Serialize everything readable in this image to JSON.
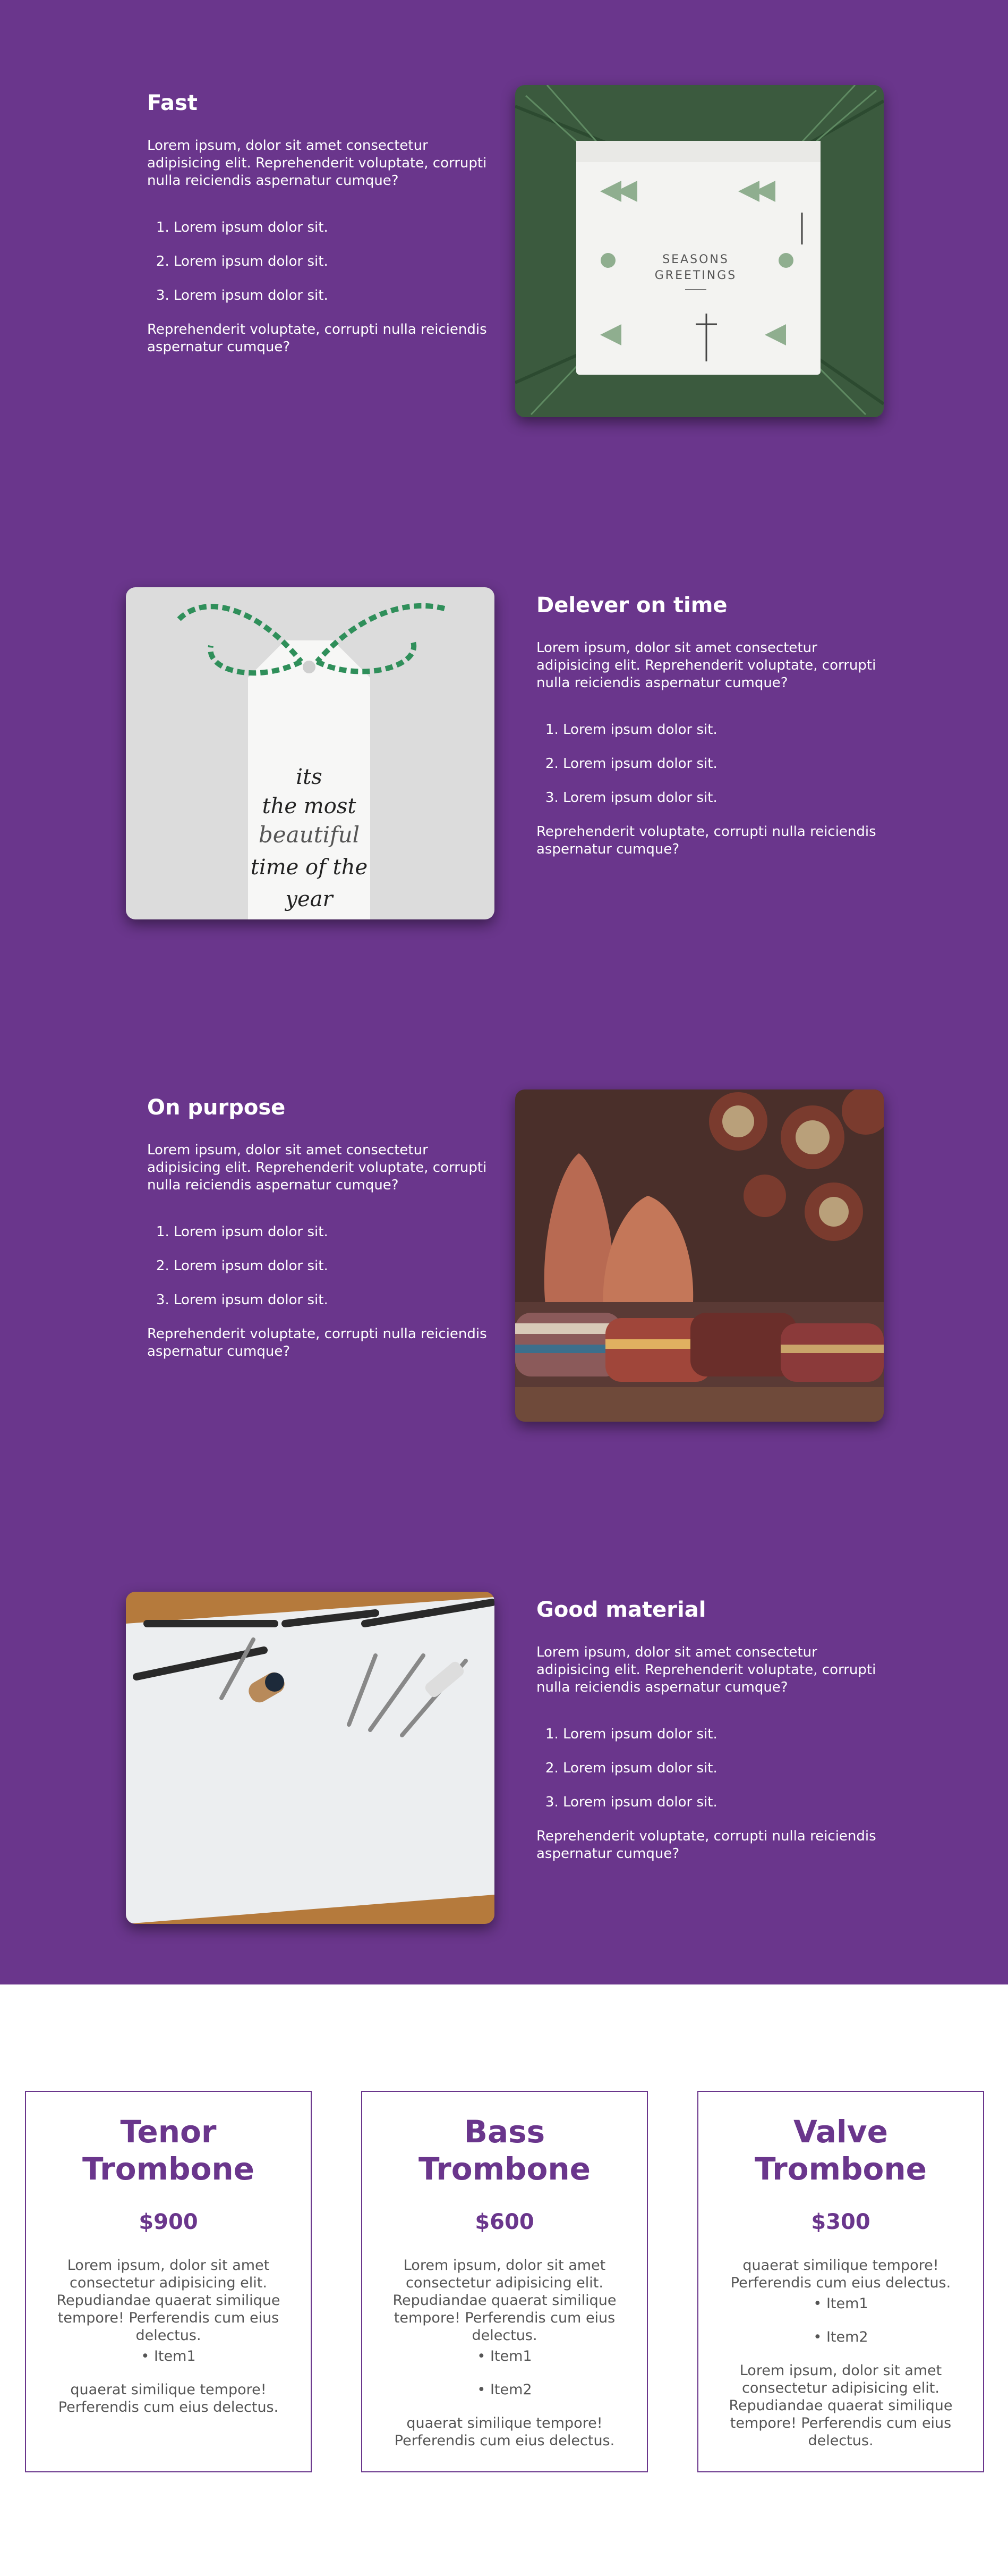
{
  "features": [
    {
      "title": "Fast",
      "intro": "Lorem ipsum, dolor sit amet consectetur adipisicing elit. Reprehenderit voluptate, corrupti nulla reiciendis aspernatur cumque?",
      "items": [
        "Lorem ipsum dolor sit.",
        "Lorem ipsum dolor sit.",
        "Lorem ipsum dolor sit."
      ],
      "outro": "Reprehenderit voluptate, corrupti nulla reiciendis aspernatur cumque?",
      "image": "seasons-greetings-gift-box-photo",
      "image_text": [
        "SEASONS",
        "GREETINGS"
      ]
    },
    {
      "title": "Delever on time",
      "intro": "Lorem ipsum, dolor sit amet consectetur adipisicing elit. Reprehenderit voluptate, corrupti nulla reiciendis aspernatur cumque?",
      "items": [
        "Lorem ipsum dolor sit.",
        "Lorem ipsum dolor sit.",
        "Lorem ipsum dolor sit."
      ],
      "outro": "Reprehenderit voluptate, corrupti nulla reiciendis aspernatur cumque?",
      "image": "gift-tag-photo",
      "image_text": [
        "its",
        "the most",
        "beautiful",
        "time of the",
        "year"
      ]
    },
    {
      "title": "On purpose",
      "intro": "Lorem ipsum, dolor sit amet consectetur adipisicing elit. Reprehenderit voluptate, corrupti nulla reiciendis aspernatur cumque?",
      "items": [
        "Lorem ipsum dolor sit.",
        "Lorem ipsum dolor sit.",
        "Lorem ipsum dolor sit."
      ],
      "outro": "Reprehenderit voluptate, corrupti nulla reiciendis aspernatur cumque?",
      "image": "clay-pots-bazaar-photo"
    },
    {
      "title": "Good material",
      "intro": "Lorem ipsum, dolor sit amet consectetur adipisicing elit. Reprehenderit voluptate, corrupti nulla reiciendis aspernatur cumque?",
      "items": [
        "Lorem ipsum dolor sit.",
        "Lorem ipsum dolor sit.",
        "Lorem ipsum dolor sit."
      ],
      "outro": "Reprehenderit voluptate, corrupti nulla reiciendis aspernatur cumque?",
      "image": "tools-on-paper-photo"
    }
  ],
  "cards": [
    {
      "title_line1": "Tenor",
      "title_line2": "Trombone",
      "price": "$900",
      "text1": "Lorem ipsum, dolor sit amet consectetur adipisicing elit. Repudiandae quaerat similique tempore! Perferendis cum eius delectus.",
      "items": [
        "Item1"
      ],
      "text2": "quaerat similique tempore! Perferendis cum eius delectus."
    },
    {
      "title_line1": "Bass",
      "title_line2": "Trombone",
      "price": "$600",
      "text1": "Lorem ipsum, dolor sit amet consectetur adipisicing elit. Repudiandae quaerat similique tempore! Perferendis cum eius delectus.",
      "items": [
        "Item1",
        "Item2"
      ],
      "text2": "quaerat similique tempore! Perferendis cum eius delectus."
    },
    {
      "title_line1": "Valve",
      "title_line2": "Trombone",
      "price": "$300",
      "text1": "quaerat similique tempore! Perferendis cum eius delectus.",
      "items": [
        "Item1",
        "Item2"
      ],
      "text2": "Lorem ipsum, dolor sit amet consectetur adipisicing elit. Repudiandae quaerat similique tempore! Perferendis cum eius delectus."
    }
  ],
  "colors": {
    "brand_purple": "#6a368c",
    "card_text": "#555555",
    "white": "#ffffff"
  }
}
